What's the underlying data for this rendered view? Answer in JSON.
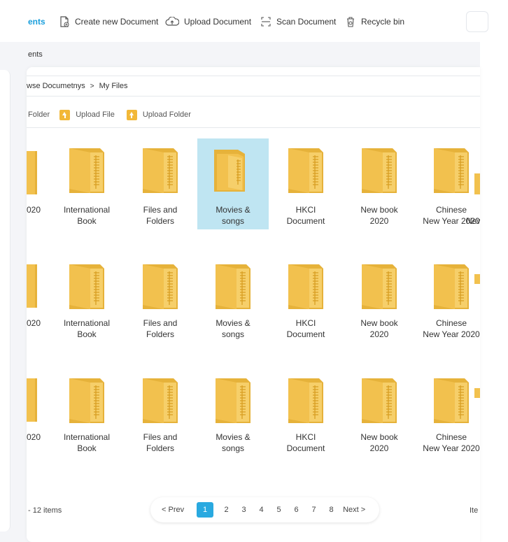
{
  "toolbar": {
    "active_label": "ents",
    "create_label": "Create new Document",
    "upload_label": "Upload Document",
    "scan_label": "Scan Document",
    "recycle_label": "Recycle bin"
  },
  "band": {
    "label": "ents"
  },
  "breadcrumb": {
    "parent": "wse Documetnys",
    "separator": ">",
    "current": "My Files"
  },
  "actions": {
    "folder_label": "Folder",
    "upload_file_label": "Upload File",
    "upload_folder_label": "Upload Folder"
  },
  "grid": {
    "rows": [
      {
        "edge_left": "020",
        "tiles": [
          "International\nBook",
          "Files and\nFolders",
          "Movies &\nsongs",
          "HKCI\nDocument",
          "New book\n2020",
          "Chinese\nNew Year 2020"
        ],
        "edge_right": "New"
      },
      {
        "edge_left": "020",
        "tiles": [
          "International\nBook",
          "Files and\nFolders",
          "Movies &\nsongs",
          "HKCI\nDocument",
          "New book\n2020",
          "Chinese\nNew Year 2020"
        ],
        "edge_right": ""
      },
      {
        "edge_left": "020",
        "tiles": [
          "International\nBook",
          "Files and\nFolders",
          "Movies &\nsongs",
          "HKCI\nDocument",
          "New book\n2020",
          "Chinese\nNew Year 2020"
        ],
        "edge_right": ""
      }
    ],
    "selected": "Movies &\nsongs"
  },
  "footer": {
    "count_label": "- 12 items",
    "prev_label": "< Prev",
    "pages": [
      "1",
      "2",
      "3",
      "4",
      "5",
      "6",
      "7",
      "8"
    ],
    "active_page": "1",
    "next_label": "Next >",
    "items_label": "Ite"
  },
  "colors": {
    "accent": "#29a9e0",
    "folder": "#f2c14e",
    "selected_bg": "#bfe5f2"
  },
  "icons": [
    "document-add-icon",
    "cloud-upload-icon",
    "scan-icon",
    "recycle-bin-icon",
    "folder-icon",
    "upload-arrow-icon"
  ]
}
